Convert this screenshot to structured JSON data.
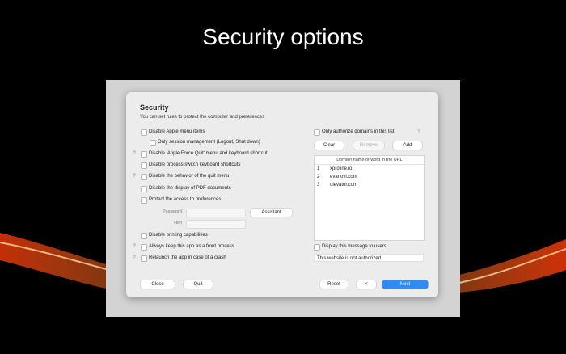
{
  "headline": "Security options",
  "dialog": {
    "title": "Security",
    "subtitle": "You can set rules to protect the computer and preferences"
  },
  "options": {
    "disable_apple_menu": "Disable Apple menu items",
    "only_session_management": "Only session management (Logout, Shut down)",
    "disable_force_quit": "Disable 'Apple Force Quit' menu and keyboard shortcut",
    "disable_process_switch": "Disable process switch keyboard shortcuts",
    "disable_quit_menu": "Disable the behavior of the quit menu",
    "disable_pdf": "Disable the display of PDF documents",
    "protect_preferences": "Protect the access to preferences",
    "password_label": "Password",
    "hint_label": "Hint",
    "assistant_button": "Assistant",
    "disable_printing": "Disable printing capabilities",
    "keep_front": "Always keep this app as a front process",
    "relaunch": "Relaunch the app in case of a crash",
    "help_mark": "?"
  },
  "domains": {
    "only_authorize": "Only authorize domains in this list",
    "clear_button": "Clear",
    "remove_button": "Remove",
    "add_button": "Add",
    "column_header": "Domain name or word in the URL",
    "rows": [
      {
        "num": "1",
        "domain": "xproline.io"
      },
      {
        "num": "2",
        "domain": "evanovi.com"
      },
      {
        "num": "3",
        "domain": "olevator.com"
      }
    ],
    "display_message": "Display this message to users",
    "message_value": "This website is not authorized"
  },
  "footer": {
    "close_button": "Close",
    "quit_button": "Quit",
    "reset_button": "Reset",
    "back_button": "<",
    "next_button": "Next"
  },
  "colors": {
    "accent": "#2d8cf6",
    "glow": "#ff5a1a"
  }
}
